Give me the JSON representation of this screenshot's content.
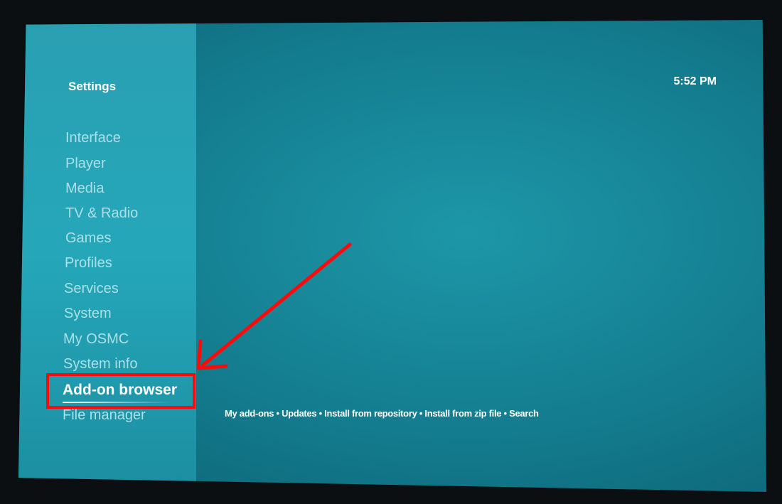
{
  "sidebar": {
    "title": "Settings",
    "items": [
      {
        "label": "Interface"
      },
      {
        "label": "Player"
      },
      {
        "label": "Media"
      },
      {
        "label": "TV & Radio"
      },
      {
        "label": "Games"
      },
      {
        "label": "Profiles"
      },
      {
        "label": "Services"
      },
      {
        "label": "System"
      },
      {
        "label": "My OSMC"
      },
      {
        "label": "System info"
      },
      {
        "label": "Add-on browser",
        "selected": true
      },
      {
        "label": "File manager"
      }
    ]
  },
  "clock": "5:52 PM",
  "submenu": "My add-ons • Updates • Install from repository • Install from zip file • Search",
  "annotation": {
    "color": "#ff0a0a"
  }
}
